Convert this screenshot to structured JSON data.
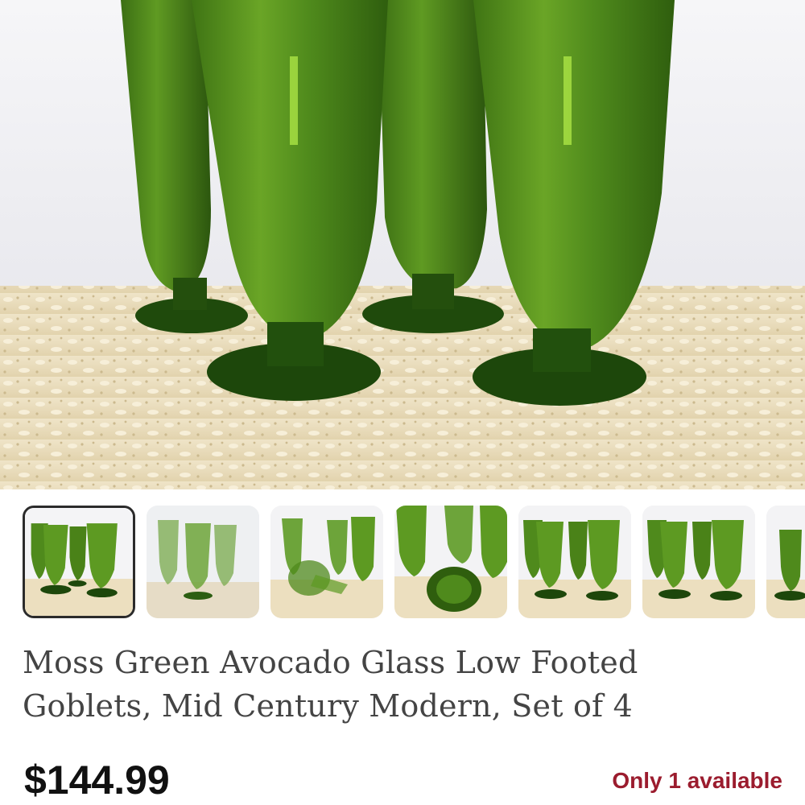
{
  "listing": {
    "title": "Moss Green Avocado Glass Low Footed Goblets, Mid Century Modern, Set of 4",
    "price": "$144.99",
    "availability": "Only 1 available"
  },
  "gallery": {
    "selected_index": 0,
    "thumbnail_count_visible": 7
  },
  "colors": {
    "availability": "#9b1c2e",
    "glass_green": "#4f8a1c",
    "glass_dark": "#1f4a0c",
    "selected_border": "#2b2b2b"
  }
}
